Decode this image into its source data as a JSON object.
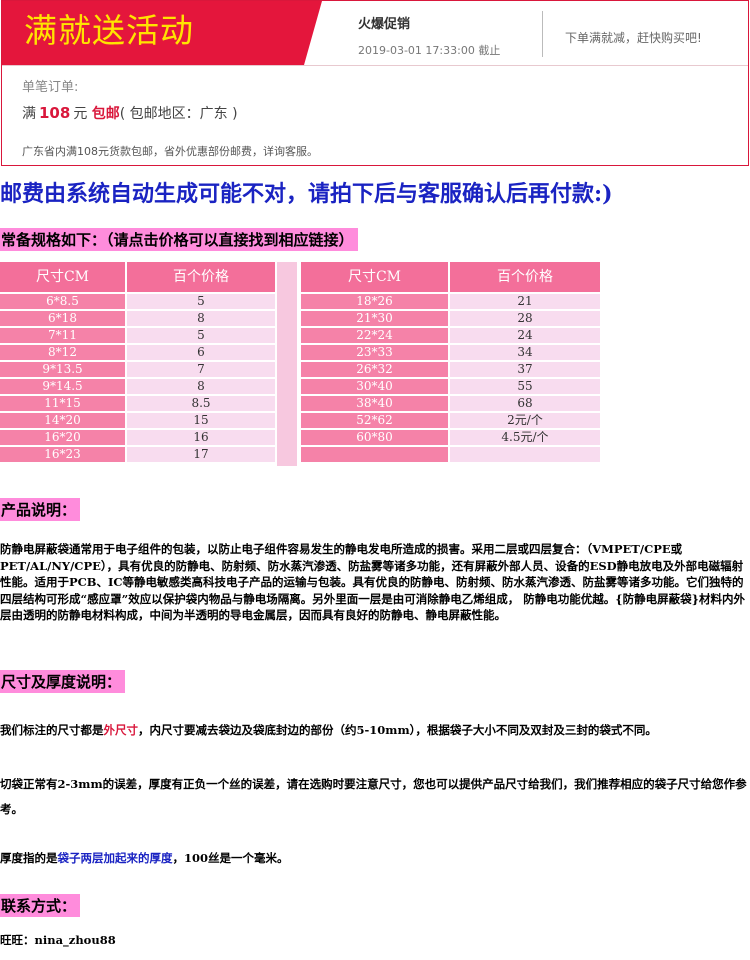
{
  "promo": {
    "title": "满就送活动",
    "label": "火爆促销",
    "time": "2019-03-01 17:33:00 截止",
    "slogan": "下单满就减，赶快购买吧!",
    "order_label": "单笔订单:",
    "order_prefix": "满",
    "order_amount": "108",
    "order_unit": "元",
    "order_free": "包邮",
    "order_region": "( 包邮地区：广东 )",
    "note": "广东省内满108元货款包邮，省外优惠部份邮费，详询客服。"
  },
  "warning": "邮费由系统自动生成可能不对，请拍下后与客服确认后再付款:)",
  "spec_heading": "常备规格如下：（请点击价格可以直接找到相应链接）",
  "table_headers": {
    "size": "尺寸CM",
    "price": "百个价格"
  },
  "table_left": [
    {
      "size": "6*8.5",
      "price": "5"
    },
    {
      "size": "6*18",
      "price": "8"
    },
    {
      "size": "7*11",
      "price": "5"
    },
    {
      "size": "8*12",
      "price": "6"
    },
    {
      "size": "9*13.5",
      "price": "7"
    },
    {
      "size": "9*14.5",
      "price": "8"
    },
    {
      "size": "11*15",
      "price": "8.5"
    },
    {
      "size": "14*20",
      "price": "15"
    },
    {
      "size": "16*20",
      "price": "16"
    },
    {
      "size": "16*23",
      "price": "17"
    }
  ],
  "table_right": [
    {
      "size": "18*26",
      "price": "21"
    },
    {
      "size": "21*30",
      "price": "28"
    },
    {
      "size": "22*24",
      "price": "24"
    },
    {
      "size": "23*33",
      "price": "34"
    },
    {
      "size": "26*32",
      "price": "37"
    },
    {
      "size": "30*40",
      "price": "55"
    },
    {
      "size": "38*40",
      "price": "68"
    },
    {
      "size": "52*62",
      "price": "2元/个"
    },
    {
      "size": "60*80",
      "price": "4.5元/个"
    },
    {
      "size": "",
      "price": ""
    }
  ],
  "product_heading": "产品说明：",
  "product_text": "防静电屏蔽袋通常用于电子组件的包装，以防止电子组件容易发生的静电发电所造成的损害。采用二层或四层复合：（VMPET/CPE或PET/AL/NY/CPE），具有优良的防静电、防射频、防水蒸汽渗透、防盐雾等诸多功能，还有屏蔽外部人员、设备的ESD静电放电及外部电磁辐射性能。适用于PCB、IC等静电敏感类高科技电子产品的运输与包装。具有优良的防静电、防射频、防水蒸汽渗透、防盐雾等诸多功能。它们独特的四层结构可形成“感应罩”效应以保护袋内物品与静电场隔离。另外里面一层是由可消除静电乙烯组成， 防静电功能优越。{防静电屏蔽袋}材料内外层由透明的防静电材料构成，中间为半透明的导电金属层，因而具有良好的防静电、静电屏蔽性能。",
  "size_heading": "尺寸及厚度说明：",
  "size_text_1a": "我们标注的尺寸都是",
  "size_text_1b": "外尺寸",
  "size_text_1c": "，内尺寸要减去袋边及袋底封边的部份（约5-10mm），根据袋子大小不同及双封及三封的袋式不同。",
  "size_text_2": "切袋正常有2-3mm的误差，厚度有正负一个丝的误差，请在选购时要注意尺寸，您也可以提供产品尺寸给我们，我们推荐相应的袋子尺寸给您作参考。",
  "size_text_3a": "厚度指的是",
  "size_text_3b": "袋子两层加起来的厚度",
  "size_text_3c": "，100丝是一个毫米。",
  "contact_heading": "联系方式：",
  "contact_text": "旺旺：nina_zhou88"
}
